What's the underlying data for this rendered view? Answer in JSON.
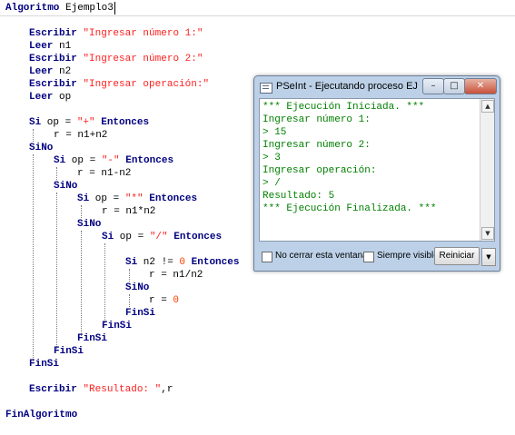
{
  "editor": {
    "lines": [
      {
        "kw": "Algoritmo",
        "rest": " Ejemplo3"
      },
      {
        "kw": "Escribir",
        "str": "\"Ingresar número 1:\""
      },
      {
        "kw": "Leer",
        "rest": " n1"
      },
      {
        "kw": "Escribir",
        "str": "\"Ingresar número 2:\""
      },
      {
        "kw": "Leer",
        "rest": " n2"
      },
      {
        "kw": "Escribir",
        "str": "\"Ingresar operación:\""
      },
      {
        "kw": "Leer",
        "rest": " op"
      },
      {
        "kw": "Si",
        "pre": " op = ",
        "str": "\"+\"",
        "kw2": "Entonces"
      },
      {
        "text": "r = n1+n2"
      },
      {
        "kw": "SiNo"
      },
      {
        "kw": "Si",
        "pre": " op = ",
        "str": "\"-\"",
        "kw2": "Entonces"
      },
      {
        "text": "r = n1-n2"
      },
      {
        "kw": "SiNo"
      },
      {
        "kw": "Si",
        "pre": " op = ",
        "str": "\"*\"",
        "kw2": "Entonces"
      },
      {
        "text": "r = n1*n2"
      },
      {
        "kw": "SiNo"
      },
      {
        "kw": "Si",
        "pre": " op = ",
        "str": "\"/\"",
        "kw2": "Entonces"
      },
      {
        "kw": "Si",
        "pre": " n2 != ",
        "num": "0",
        "kw2": "Entonces"
      },
      {
        "text": "r = n1/n2"
      },
      {
        "kw": "SiNo"
      },
      {
        "text": "r = ",
        "num": "0"
      },
      {
        "kw": "FinSi"
      },
      {
        "kw": "FinSi"
      },
      {
        "kw": "FinSi"
      },
      {
        "kw": "FinSi"
      },
      {
        "kw": "FinSi"
      },
      {
        "kw": "Escribir",
        "str": "\"Resultado: \"",
        "rest": ",r"
      },
      {
        "kw": "FinAlgoritmo"
      }
    ]
  },
  "console_window": {
    "title": "PSeInt - Ejecutando proceso EJEM...",
    "lines": [
      "*** Ejecución Iniciada. ***",
      "Ingresar número 1:",
      "> 15",
      "Ingresar número 2:",
      "> 3",
      "Ingresar operación:",
      "> /",
      "Resultado: 5",
      "*** Ejecución Finalizada. ***"
    ],
    "no_cerrar_label": "No cerrar esta ventana",
    "siempre_visible_label": "Siempre visible",
    "reiniciar_label": "Reiniciar",
    "icons": [
      "app-icon",
      "minimize-icon",
      "maximize-icon",
      "close-icon",
      "scroll-up-arrow",
      "scroll-down-arrow",
      "dropdown-arrow"
    ],
    "colors": {
      "output_text": "#008000",
      "keyword": "#000080",
      "string": "#ff2020",
      "number": "#ff4000"
    }
  }
}
